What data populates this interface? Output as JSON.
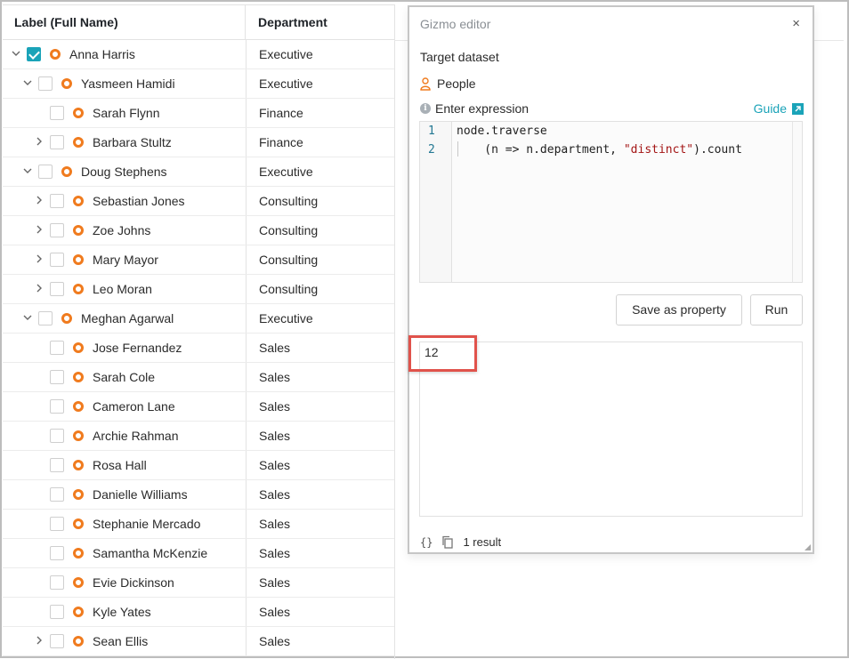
{
  "grid": {
    "header_label": "Label (Full Name)",
    "header_department": "Department",
    "rows": [
      {
        "name": "Anna Harris",
        "department": "Executive"
      },
      {
        "name": "Yasmeen Hamidi",
        "department": "Executive"
      },
      {
        "name": "Sarah Flynn",
        "department": "Finance"
      },
      {
        "name": "Barbara Stultz",
        "department": "Finance"
      },
      {
        "name": "Doug Stephens",
        "department": "Executive"
      },
      {
        "name": "Sebastian Jones",
        "department": "Consulting"
      },
      {
        "name": "Zoe Johns",
        "department": "Consulting"
      },
      {
        "name": "Mary Mayor",
        "department": "Consulting"
      },
      {
        "name": "Leo Moran",
        "department": "Consulting"
      },
      {
        "name": "Meghan Agarwal",
        "department": "Executive"
      },
      {
        "name": "Jose Fernandez",
        "department": "Sales"
      },
      {
        "name": "Sarah Cole",
        "department": "Sales"
      },
      {
        "name": "Cameron Lane",
        "department": "Sales"
      },
      {
        "name": "Archie Rahman",
        "department": "Sales"
      },
      {
        "name": "Rosa Hall",
        "department": "Sales"
      },
      {
        "name": "Danielle Williams",
        "department": "Sales"
      },
      {
        "name": "Stephanie Mercado",
        "department": "Sales"
      },
      {
        "name": "Samantha McKenzie",
        "department": "Sales"
      },
      {
        "name": "Evie Dickinson",
        "department": "Sales"
      },
      {
        "name": "Kyle Yates",
        "department": "Sales"
      },
      {
        "name": "Sean Ellis",
        "department": "Sales"
      }
    ]
  },
  "gizmo": {
    "title": "Gizmo editor",
    "close": "×",
    "target_label": "Target dataset",
    "dataset_name": "People",
    "expression_label": "Enter expression",
    "guide_label": "Guide",
    "code_lines": [
      "1",
      "2"
    ],
    "code_line1": "node.traverse",
    "code_line2_prefix": "    (n => n.department, ",
    "code_line2_string": "\"distinct\"",
    "code_line2_suffix": ").count",
    "save_button": "Save as property",
    "run_button": "Run",
    "result_value": "12",
    "footer_braces": "{}",
    "result_count": "1 result"
  },
  "colors": {
    "accent": "#1aa3b8",
    "node_icon": "#f07b1e",
    "highlight": "#e0524b"
  }
}
